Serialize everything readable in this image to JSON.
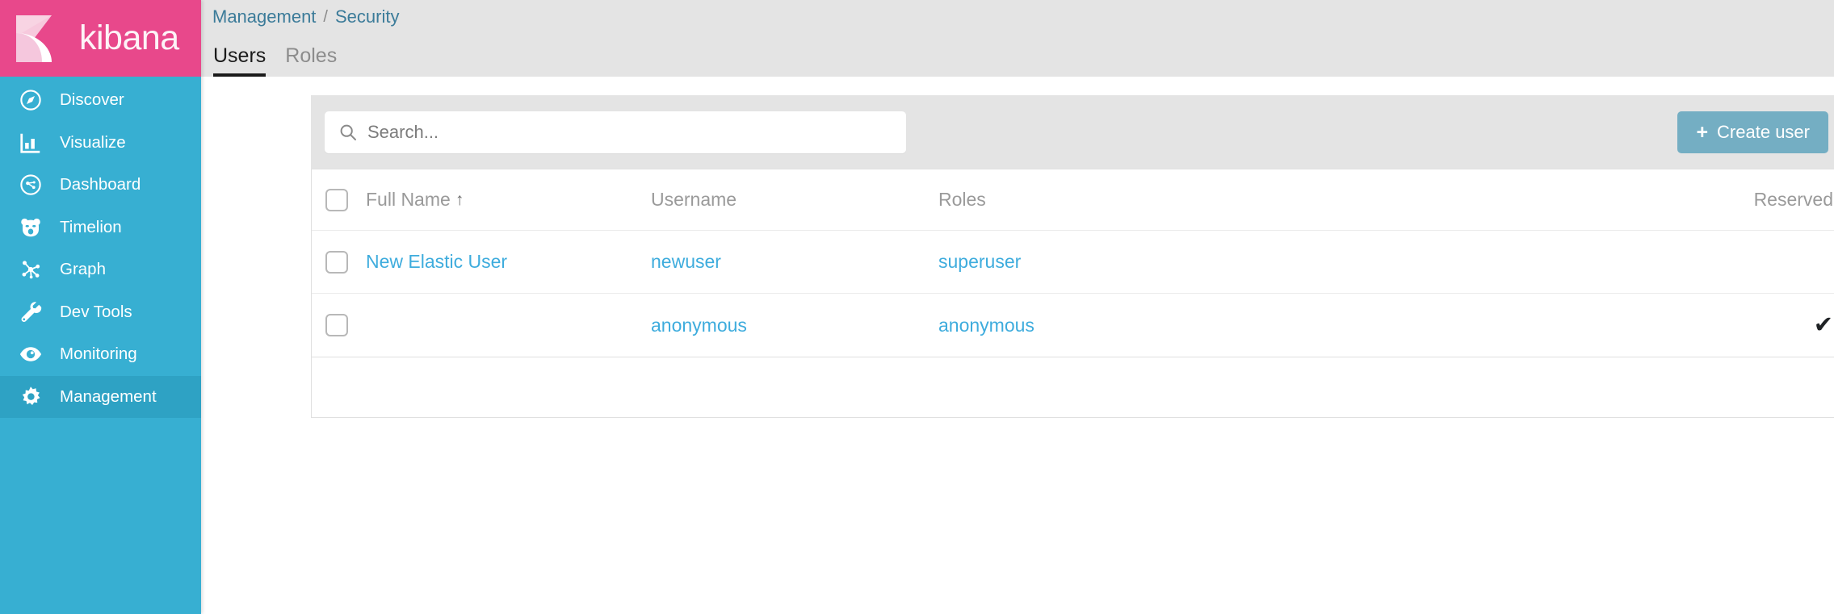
{
  "brand": {
    "name": "kibana",
    "logo_icon": "kibana-logo-icon",
    "background": "#e8488b"
  },
  "sidebar": {
    "background": "#37afd2",
    "active_background": "#2ea2c4",
    "items": [
      {
        "label": "Discover",
        "icon": "compass-icon",
        "active": false
      },
      {
        "label": "Visualize",
        "icon": "bar-chart-icon",
        "active": false
      },
      {
        "label": "Dashboard",
        "icon": "dashboard-icon",
        "active": false
      },
      {
        "label": "Timelion",
        "icon": "bear-icon",
        "active": false
      },
      {
        "label": "Graph",
        "icon": "graph-icon",
        "active": false
      },
      {
        "label": "Dev Tools",
        "icon": "wrench-icon",
        "active": false
      },
      {
        "label": "Monitoring",
        "icon": "eye-icon",
        "active": false
      },
      {
        "label": "Management",
        "icon": "gear-icon",
        "active": true
      }
    ]
  },
  "breadcrumb": {
    "items": [
      "Management",
      "Security"
    ],
    "separator": "/",
    "link_color": "#3b7b99"
  },
  "tabs": [
    {
      "label": "Users",
      "active": true
    },
    {
      "label": "Roles",
      "active": false
    }
  ],
  "toolbar": {
    "search": {
      "placeholder": "Search...",
      "value": "",
      "icon": "search-icon"
    },
    "create_button": {
      "label": "Create user",
      "icon": "plus-icon",
      "color": "#74aec3"
    }
  },
  "table": {
    "columns": [
      {
        "key": "full_name",
        "label": "Full Name",
        "sorted": true,
        "sort_indicator": "↑"
      },
      {
        "key": "username",
        "label": "Username",
        "sorted": false,
        "sort_indicator": ""
      },
      {
        "key": "roles",
        "label": "Roles",
        "sorted": false,
        "sort_indicator": ""
      },
      {
        "key": "reserved",
        "label": "Reserved",
        "sorted": false,
        "sort_indicator": ""
      }
    ],
    "select_all_checked": false,
    "rows": [
      {
        "selected": false,
        "full_name": "New Elastic User",
        "username": "newuser",
        "roles": "superuser",
        "reserved": false,
        "reserved_mark": ""
      },
      {
        "selected": false,
        "full_name": "",
        "username": "anonymous",
        "roles": "anonymous",
        "reserved": true,
        "reserved_mark": "✔"
      }
    ],
    "link_color": "#3eacdd"
  }
}
